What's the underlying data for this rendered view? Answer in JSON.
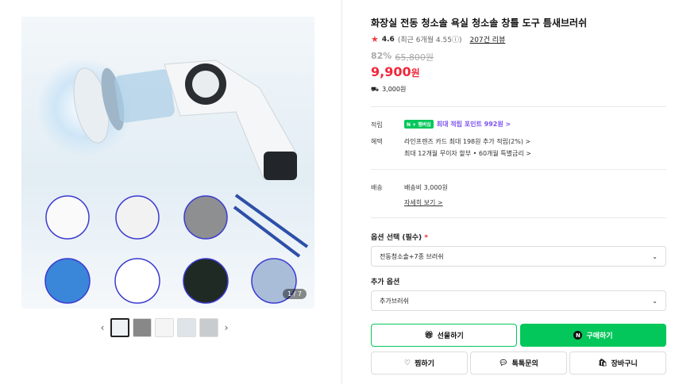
{
  "gallery": {
    "counter": "1 / 7"
  },
  "product": {
    "title": "화장실 전동 청소솔 욕실 청소솔 창틀 도구 틈새브러쉬",
    "rating": "4.6",
    "rating_meta": "(최근 6개월 4.55ⓘ)",
    "reviews": "207건 리뷰",
    "discount": "82%",
    "original_price": "65,800원",
    "price": "9,900",
    "price_unit": "원",
    "shipping_fee": "3,000원"
  },
  "info": {
    "points_label": "적립",
    "npay": "N + 멤버십",
    "points_value": "최대 적립 포인트 992원 >",
    "benefit_label": "혜택",
    "benefit_line1": "라인프렌즈 카드 최대 198원 추가 적립(2%) >",
    "benefit_line2": "최대 12개월 무이자 할부 • 60개월 특별금리 >",
    "delivery_label": "배송",
    "delivery_value": "배송비 3,000원",
    "delivery_more": "자세히 보기 >"
  },
  "options": {
    "label": "옵션 선택 (필수)",
    "required_mark": "*",
    "selected": "전동청소솔+7종 브러쉬",
    "extra_label": "추가 옵션",
    "extra_selected": "추가브러쉬"
  },
  "buttons": {
    "gift": "선물하기",
    "buy": "구매하기",
    "wish": "찜하기",
    "talk": "톡톡문의",
    "cart": "장바구니"
  },
  "colors": {
    "accent_green": "#03c75a",
    "price_red": "#f0273b",
    "point_purple": "#7b4ff2"
  }
}
